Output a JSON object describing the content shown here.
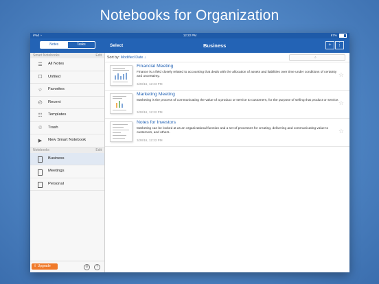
{
  "headline": "Notebooks for Organization",
  "status_bar": {
    "device": "iPad",
    "wifi": "◔",
    "time": "12:22 PM",
    "battery": "67%"
  },
  "navbar": {
    "tabs": [
      {
        "label": "Notes",
        "active": true
      },
      {
        "label": "Tasks",
        "active": false
      }
    ],
    "select_label": "Select",
    "title": "Business",
    "actions": [
      "+",
      "⋮"
    ]
  },
  "sidebar": {
    "smart_header": "Smart Notebooks",
    "smart_edit": "Edit",
    "smart_items": [
      {
        "label": "All Notes",
        "icon": "all-notes-icon",
        "glyph": "☰"
      },
      {
        "label": "Unfiled",
        "icon": "unfiled-icon",
        "glyph": "☐"
      },
      {
        "label": "Favorites",
        "icon": "star-icon",
        "glyph": "☆"
      },
      {
        "label": "Recent",
        "icon": "clock-icon",
        "glyph": "◴"
      },
      {
        "label": "Templates",
        "icon": "templates-icon",
        "glyph": "☷"
      },
      {
        "label": "Trash",
        "icon": "trash-icon",
        "glyph": "♲"
      },
      {
        "label": "New Smart Notebook",
        "icon": "new-smart-notebook-icon",
        "glyph": "▶"
      }
    ],
    "notebooks_header": "Notebooks",
    "notebooks_edit": "Edit",
    "notebooks": [
      {
        "label": "Business",
        "selected": true
      },
      {
        "label": "Meetings",
        "selected": false
      },
      {
        "label": "Personal",
        "selected": false
      }
    ],
    "upgrade_label": "⇧ Upgrade",
    "footer_icons": [
      "gear-icon",
      "help-icon"
    ]
  },
  "content": {
    "sort_prefix": "Sort by:",
    "sort_value": "Modified Date ↓",
    "search_icon": "⌕",
    "notes": [
      {
        "title": "Financial Meeting",
        "snippet": "Finance is a field closely related to accounting that deals with the allocation of assets and liabilities over time under conditions of certainty and uncertainty.",
        "date": "3/28/16, 12:23 PM"
      },
      {
        "title": "Marketing Meeting",
        "snippet": "Marketing is the process of communicating the value of a product or service to customers, for the purpose of selling that product or service.",
        "date": "3/28/16, 12:22 PM"
      },
      {
        "title": "Notes for Investors",
        "snippet": "Marketing can be looked at as an organizational function and a set of processes for creating, delivering and communicating value to customers, and others.",
        "date": "3/28/16, 12:22 PM"
      }
    ]
  },
  "colors": {
    "accent": "#2363b5",
    "upgrade": "#f07a2a",
    "background": "#4f85c4"
  }
}
